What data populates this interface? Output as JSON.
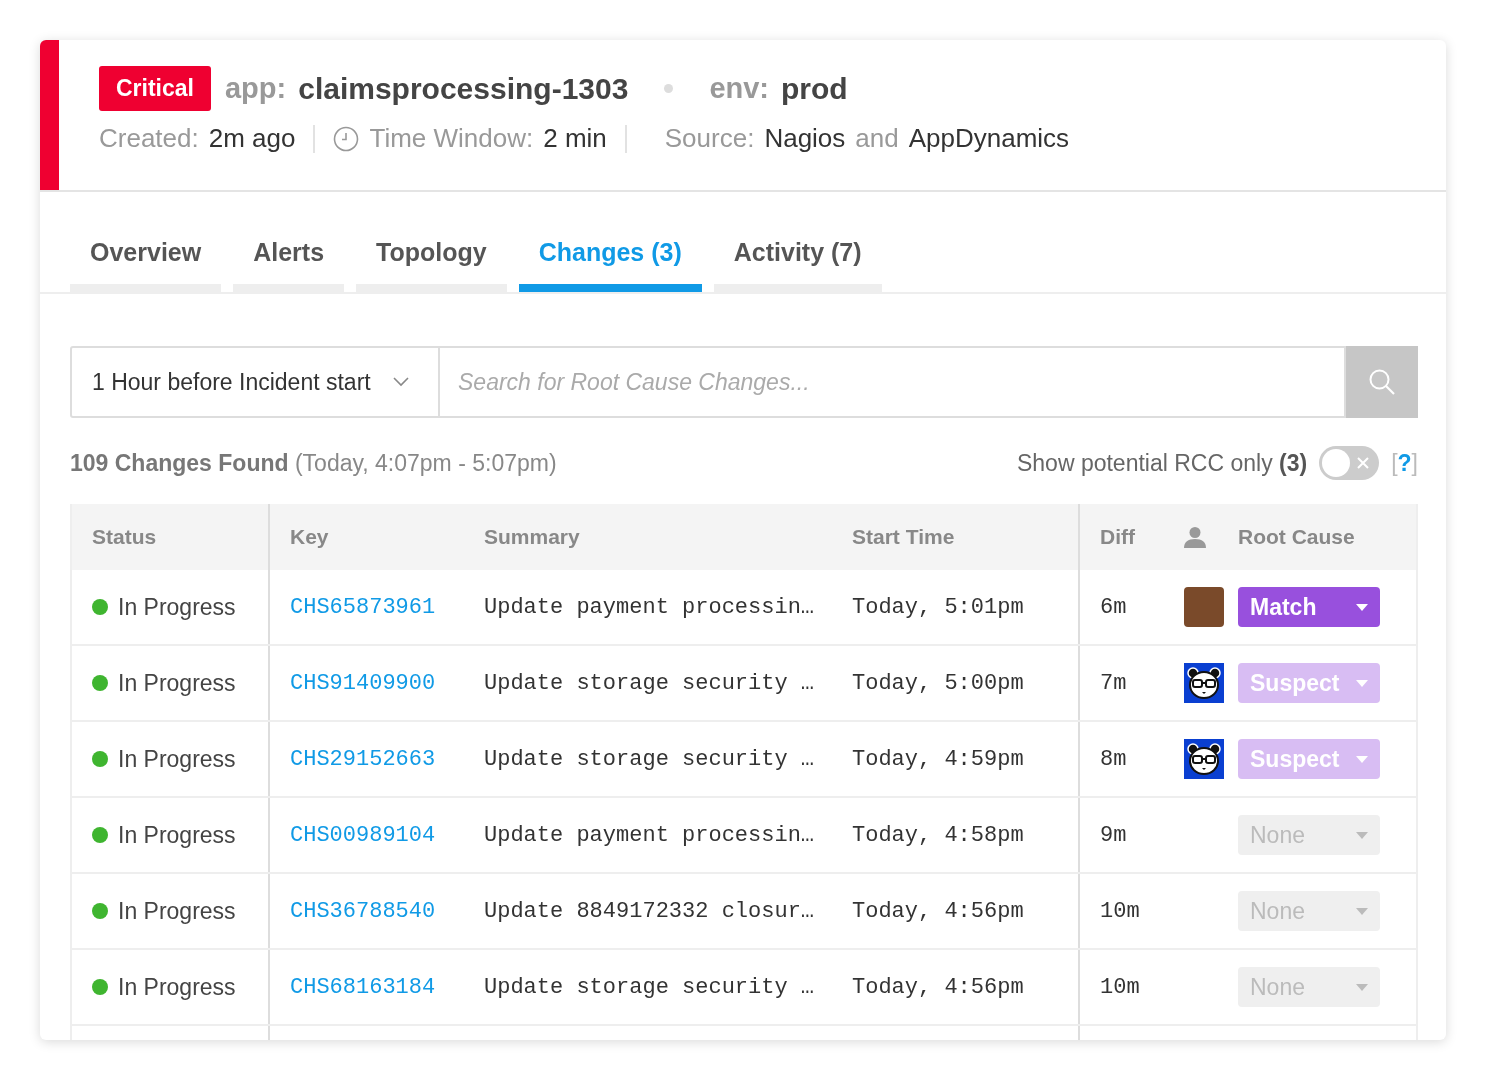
{
  "incident": {
    "severity": "Critical",
    "app_label": "app:",
    "app": "claimsprocessing-1303",
    "env_label": "env:",
    "env": "prod",
    "created_label": "Created:",
    "created": "2m ago",
    "window_label": "Time Window:",
    "window": "2 min",
    "source_label": "Source:",
    "source_a": "Nagios",
    "source_and": "and",
    "source_b": "AppDynamics"
  },
  "tabs": [
    {
      "label": "Overview",
      "selected": false
    },
    {
      "label": "Alerts",
      "selected": false
    },
    {
      "label": "Topology",
      "selected": false
    },
    {
      "label": "Changes (3)",
      "selected": true
    },
    {
      "label": "Activity (7)",
      "selected": false
    }
  ],
  "filter": {
    "range": "1 Hour before Incident start",
    "placeholder": "Search for Root Cause Changes..."
  },
  "summary": {
    "count": "109 Changes Found",
    "range": "(Today, 4:07pm - 5:07pm)",
    "rcc_label": "Show potential RCC only",
    "rcc_count": "(3)",
    "rcc_on": false,
    "help": "[**?**]"
  },
  "table": {
    "columns": [
      "Status",
      "Key",
      "Summary",
      "Start Time",
      "Diff",
      "Root Cause"
    ],
    "rows": [
      {
        "status": "In Progress",
        "key": "CHS65873961",
        "summary": "Update payment processin…",
        "start": "Today, 5:01pm",
        "diff": "6m",
        "avatar": {
          "kind": "photo"
        },
        "root_cause": {
          "label": "Match",
          "kind": "match"
        }
      },
      {
        "status": "In Progress",
        "key": "CHS91409900",
        "summary": "Update storage security …",
        "start": "Today, 5:00pm",
        "diff": "7m",
        "avatar": {
          "kind": "panda"
        },
        "root_cause": {
          "label": "Suspect",
          "kind": "suspect"
        }
      },
      {
        "status": "In Progress",
        "key": "CHS29152663",
        "summary": "Update storage security …",
        "start": "Today, 4:59pm",
        "diff": "8m",
        "avatar": {
          "kind": "panda"
        },
        "root_cause": {
          "label": "Suspect",
          "kind": "suspect"
        }
      },
      {
        "status": "In Progress",
        "key": "CHS00989104",
        "summary": "Update payment processin…",
        "start": "Today, 4:58pm",
        "diff": "9m",
        "root_cause": {
          "label": "None",
          "kind": "none"
        }
      },
      {
        "status": "In Progress",
        "key": "CHS36788540",
        "summary": "Update 8849172332 closur…",
        "start": "Today, 4:56pm",
        "diff": "10m",
        "root_cause": {
          "label": "None",
          "kind": "none"
        }
      },
      {
        "status": "In Progress",
        "key": "CHS68163184",
        "summary": "Update storage security …",
        "start": "Today, 4:56pm",
        "diff": "10m",
        "root_cause": {
          "label": "None",
          "kind": "none"
        }
      }
    ]
  }
}
